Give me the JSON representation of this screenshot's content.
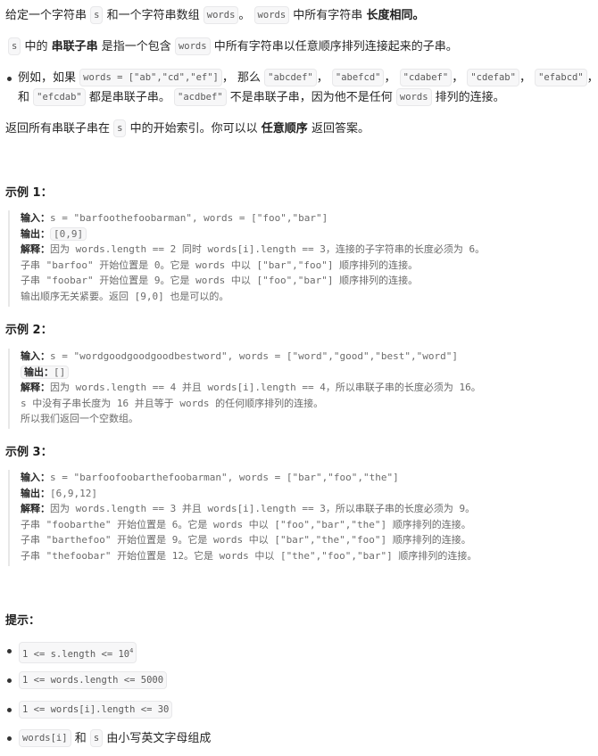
{
  "intro": {
    "line1": {
      "t1": "给定一个字符串",
      "c1": "s",
      "t2": "和一个字符串数组",
      "c2": "words",
      "t3": "。",
      "c3": "words",
      "t4": "中所有字符串",
      "b1": "长度相同。"
    },
    "line2": {
      "c1": "s",
      "t1": "中的",
      "b1": "串联子串",
      "t2": "是指一个包含",
      "c2": "words",
      "t3": "中所有字符串以任意顺序排列连接起来的子串。"
    },
    "example_bullet": {
      "t1": "例如，如果",
      "c1": "words = [\"ab\",\"cd\",\"ef\"]",
      "t2": "，  那么",
      "c2": "\"abcdef\"",
      "t3": "，",
      "c3": "\"abefcd\"",
      "t4": "，",
      "c4": "\"cdabef\"",
      "t5": "，",
      "c5": "\"cdefab\"",
      "t6": "，",
      "c6": "\"efabcd\"",
      "t7": "，",
      "t8": "和",
      "c7": "\"efcdab\"",
      "t9": "都是串联子串。",
      "c8": "\"acdbef\"",
      "t10": "不是串联子串，因为他不是任何",
      "c9": "words",
      "t11": "排列的连接。"
    },
    "line3": {
      "t1": "返回所有串联子串在",
      "c1": "s",
      "t2": "中的开始索引。你可以以",
      "b1": "任意顺序",
      "t3": "返回答案。"
    }
  },
  "examples": [
    {
      "title": "示例 1：",
      "input_label": "输入：",
      "input": "s = \"barfoothefoobarman\", words = [\"foo\",\"bar\"]",
      "output_label": "输出：",
      "output": "[0,9]",
      "explain_label": "解释：",
      "explain": [
        "因为 words.length == 2 同时 words[i].length == 3，连接的子字符串的长度必须为 6。",
        "子串 \"barfoo\" 开始位置是 0。它是 words 中以 [\"bar\",\"foo\"] 顺序排列的连接。",
        "子串 \"foobar\" 开始位置是 9。它是 words 中以 [\"foo\",\"bar\"] 顺序排列的连接。",
        "输出顺序无关紧要。返回 [9,0] 也是可以的。"
      ]
    },
    {
      "title": "示例 2：",
      "input_label": "输入：",
      "input": "s = \"wordgoodgoodgoodbestword\", words = [\"word\",\"good\",\"best\",\"word\"]",
      "output_label": "输出：",
      "output": "[]",
      "explain_label": "解释：",
      "explain": [
        "因为 words.length == 4 并且 words[i].length == 4，所以串联子串的长度必须为 16。",
        "s 中没有子串长度为 16 并且等于 words 的任何顺序排列的连接。",
        "所以我们返回一个空数组。"
      ]
    },
    {
      "title": "示例 3：",
      "input_label": "输入：",
      "input": "s = \"barfoofoobarthefoobarman\", words = [\"bar\",\"foo\",\"the\"]",
      "output_label": "输出：",
      "output": "[6,9,12]",
      "explain_label": "解释：",
      "explain": [
        "因为 words.length == 3 并且 words[i].length == 3，所以串联子串的长度必须为 9。",
        "子串 \"foobarthe\" 开始位置是 6。它是 words 中以 [\"foo\",\"bar\",\"the\"] 顺序排列的连接。",
        "子串 \"barthefoo\" 开始位置是 9。它是 words 中以 [\"bar\",\"the\",\"foo\"] 顺序排列的连接。",
        "子串 \"thefoobar\" 开始位置是 12。它是 words 中以 [\"the\",\"foo\",\"bar\"] 顺序排列的连接。"
      ]
    }
  ],
  "hints": {
    "title": "提示：",
    "items": [
      {
        "code": "1 <= s.length <= 10",
        "sup": "4"
      },
      {
        "code": "1 <= words.length <= 5000"
      },
      {
        "code": "1 <= words[i].length <= 30"
      },
      {
        "c1": "words[i]",
        "t1": "和",
        "c2": "s",
        "t2": "由小写英文字母组成"
      }
    ]
  }
}
